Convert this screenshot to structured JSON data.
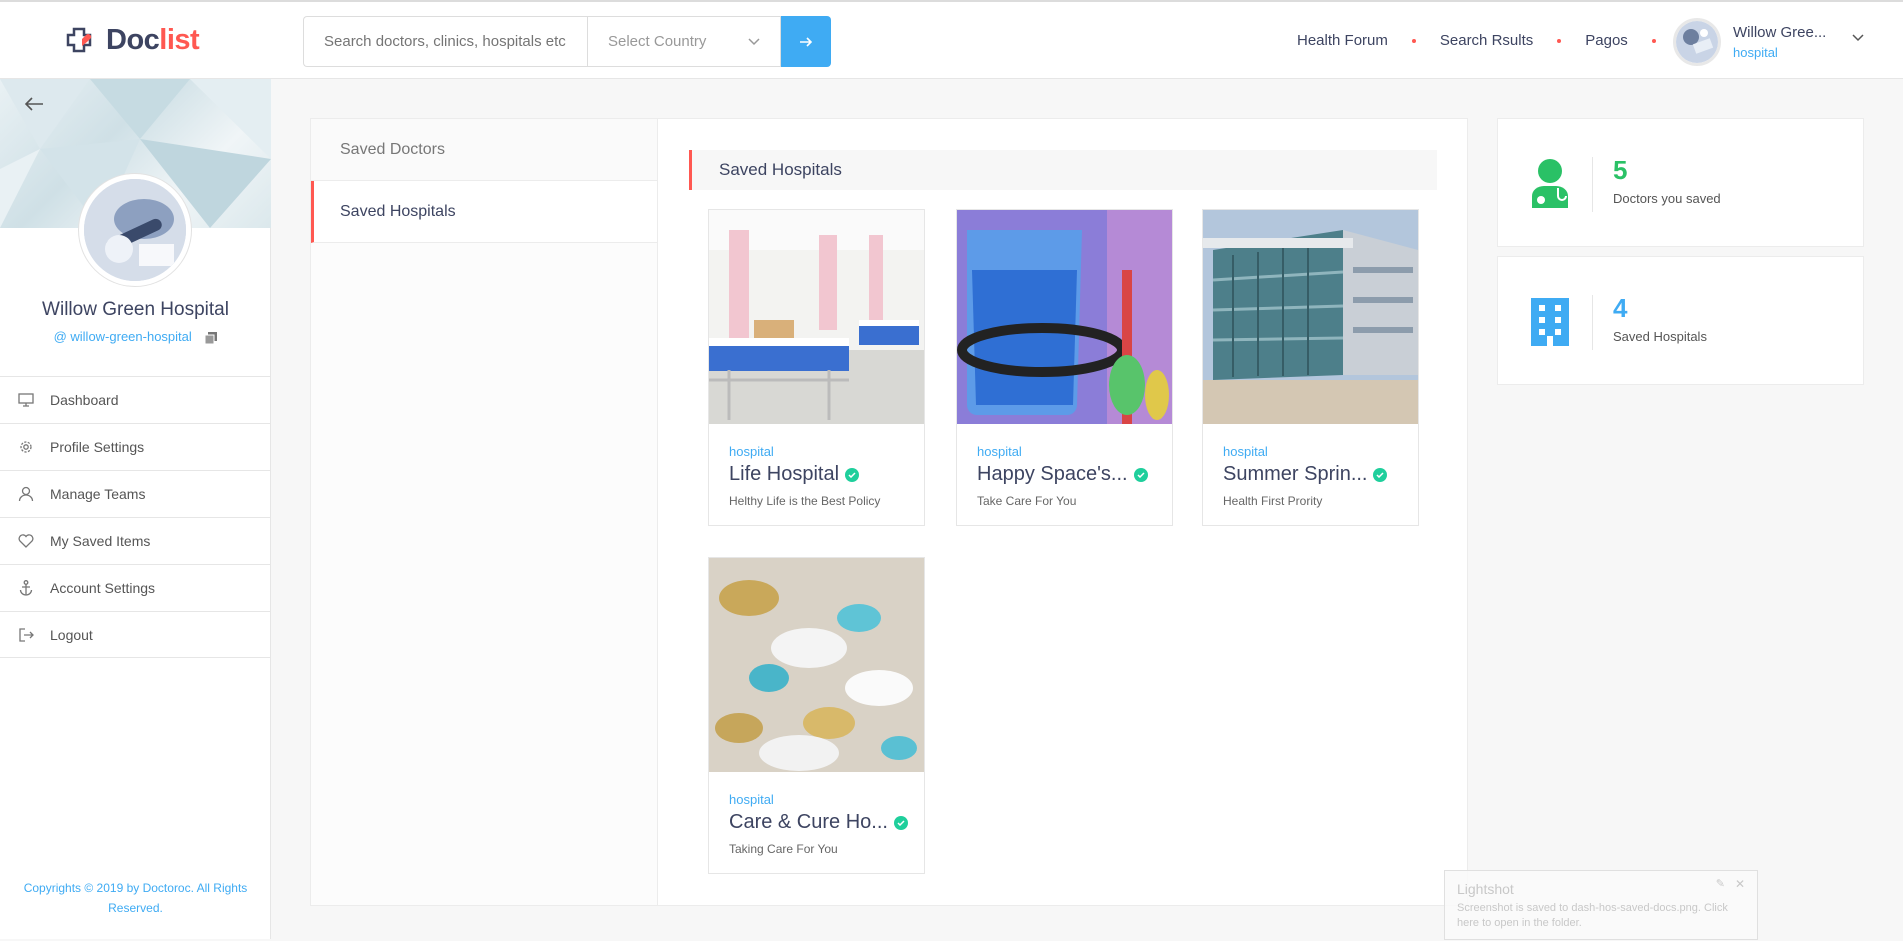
{
  "brand": {
    "part1": "Doc",
    "part2": "list"
  },
  "search": {
    "placeholder": "Search doctors, clinics, hospitals etc.",
    "country_placeholder": "Select Country"
  },
  "topnav": [
    "Health Forum",
    "Search Rsults",
    "Pagos"
  ],
  "user": {
    "name": "Willow Gree...",
    "role": "hospital"
  },
  "profile": {
    "name": "Willow Green Hospital",
    "handle": "@ willow-green-hospital"
  },
  "menu": [
    "Dashboard",
    "Profile Settings",
    "Manage Teams",
    "My Saved Items",
    "Account Settings",
    "Logout"
  ],
  "copyright": "Copyrights © 2019 by Doctoroc. All Rights Reserved.",
  "tabs": [
    "Saved Doctors",
    "Saved Hospitals"
  ],
  "section_title": "Saved Hospitals",
  "hospitals": [
    {
      "category": "hospital",
      "name": "Life Hospital",
      "tagline": "Helthy Life is the Best Policy"
    },
    {
      "category": "hospital",
      "name": "Happy Space's...",
      "tagline": "Take Care For You"
    },
    {
      "category": "hospital",
      "name": "Summer Sprin...",
      "tagline": "Health First Prority"
    },
    {
      "category": "hospital",
      "name": "Care & Cure Ho...",
      "tagline": "Taking Care For You"
    }
  ],
  "stats": [
    {
      "value": "5",
      "label": "Doctors you saved",
      "color": "#2ac166",
      "icon": "doctor-icon"
    },
    {
      "value": "4",
      "label": "Saved Hospitals",
      "color": "#3fabf3",
      "icon": "hospital-building-icon"
    }
  ],
  "toast": {
    "title": "Lightshot",
    "message": "Screenshot is saved to dash-hos-saved-docs.png. Click here to open in the folder."
  },
  "colors": {
    "accent": "#ff5851",
    "primary": "#3fabf3",
    "dark": "#3d4461",
    "verified": "#1fcf9c"
  }
}
